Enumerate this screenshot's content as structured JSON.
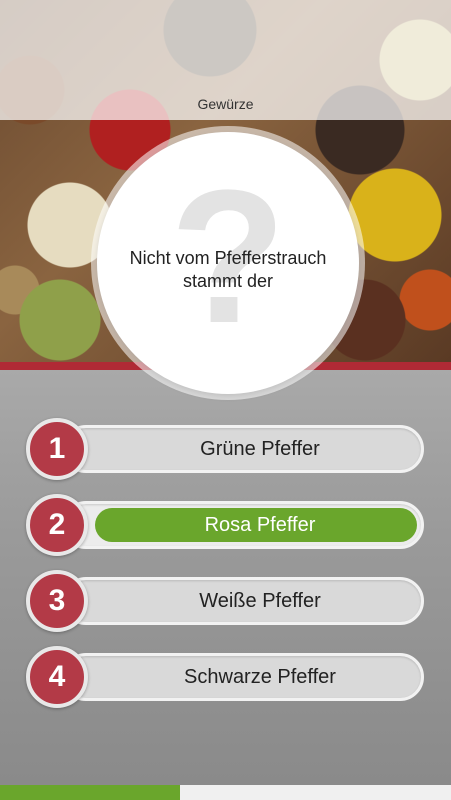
{
  "header": {
    "category": "Gewürze"
  },
  "question": {
    "text": "Nicht vom Pfefferstrauch stammt der",
    "mark": "?"
  },
  "answers": [
    {
      "number": "1",
      "label": "Grüne Pfeffer",
      "selected": false
    },
    {
      "number": "2",
      "label": "Rosa Pfeffer",
      "selected": true
    },
    {
      "number": "3",
      "label": "Weiße Pfeffer",
      "selected": false
    },
    {
      "number": "4",
      "label": "Schwarze Pfeffer",
      "selected": false
    }
  ],
  "progress": {
    "fraction": 0.4
  },
  "colors": {
    "accent_red": "#b33a47",
    "selected_green": "#6aa62c",
    "panel_gray": "#9a9a9a"
  }
}
